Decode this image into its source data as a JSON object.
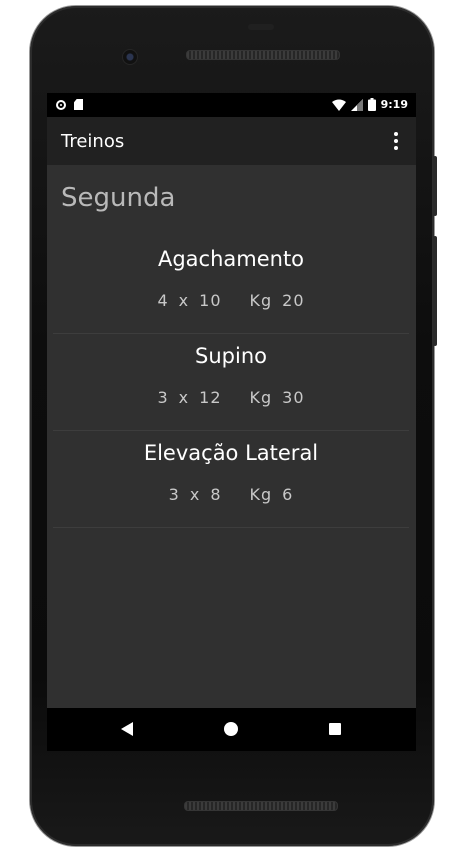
{
  "status_bar": {
    "time": "9:19",
    "left_icons": [
      "record-icon",
      "sd-card-icon"
    ],
    "right_icons": [
      "wifi-icon",
      "signal-icon",
      "battery-icon"
    ]
  },
  "appbar": {
    "title": "Treinos",
    "overflow_icon": "more-vert-icon"
  },
  "workout": {
    "day": "Segunda",
    "exercises": [
      {
        "name": "Agachamento",
        "sets": "4",
        "x": "x",
        "reps": "10",
        "weight_label": "Kg",
        "weight": "20"
      },
      {
        "name": "Supino",
        "sets": "3",
        "x": "x",
        "reps": "12",
        "weight_label": "Kg",
        "weight": "30"
      },
      {
        "name": "Elevação Lateral",
        "sets": "3",
        "x": "x",
        "reps": "8",
        "weight_label": "Kg",
        "weight": "6"
      }
    ]
  },
  "navbar": {
    "back_icon": "back-triangle-icon",
    "home_icon": "home-circle-icon",
    "recents_icon": "recents-square-icon"
  },
  "colors": {
    "appbar_bg": "#212121",
    "content_bg": "#303030",
    "day_title": "#b9b9b9",
    "exercise_name": "#ffffff",
    "stats_text": "#c8c8c8",
    "divider": "#3d3d3d"
  }
}
